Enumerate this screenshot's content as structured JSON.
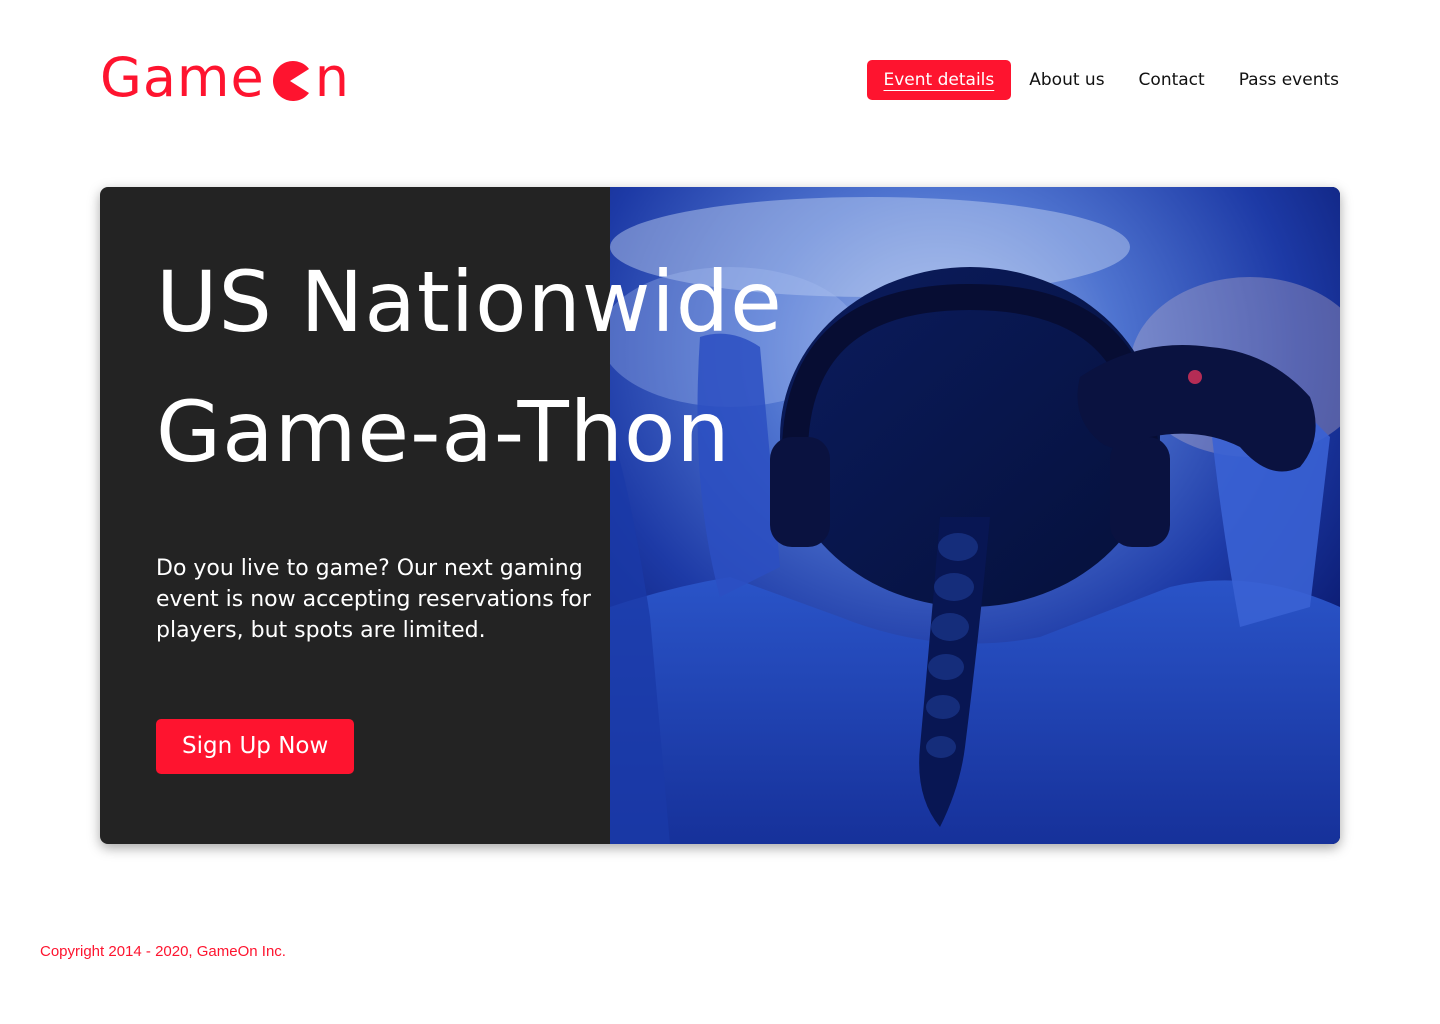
{
  "brand": {
    "logo_text_before": "Game",
    "logo_text_after": "n",
    "color": "#FE142F"
  },
  "nav": {
    "items": [
      {
        "label": "Event details",
        "active": true
      },
      {
        "label": "About us",
        "active": false
      },
      {
        "label": "Contact",
        "active": false
      },
      {
        "label": "Pass events",
        "active": false
      }
    ]
  },
  "hero": {
    "title_line1": "US Nationwide",
    "title_line2": "Game-a-Thon",
    "description": "Do you live to game? Our next gaming event is now accepting reservations for players, but spots are limited.",
    "cta_label": "Sign Up Now",
    "panel_color": "#232323"
  },
  "footer": {
    "copyright": "Copyright 2014 - 2020, GameOn Inc."
  }
}
